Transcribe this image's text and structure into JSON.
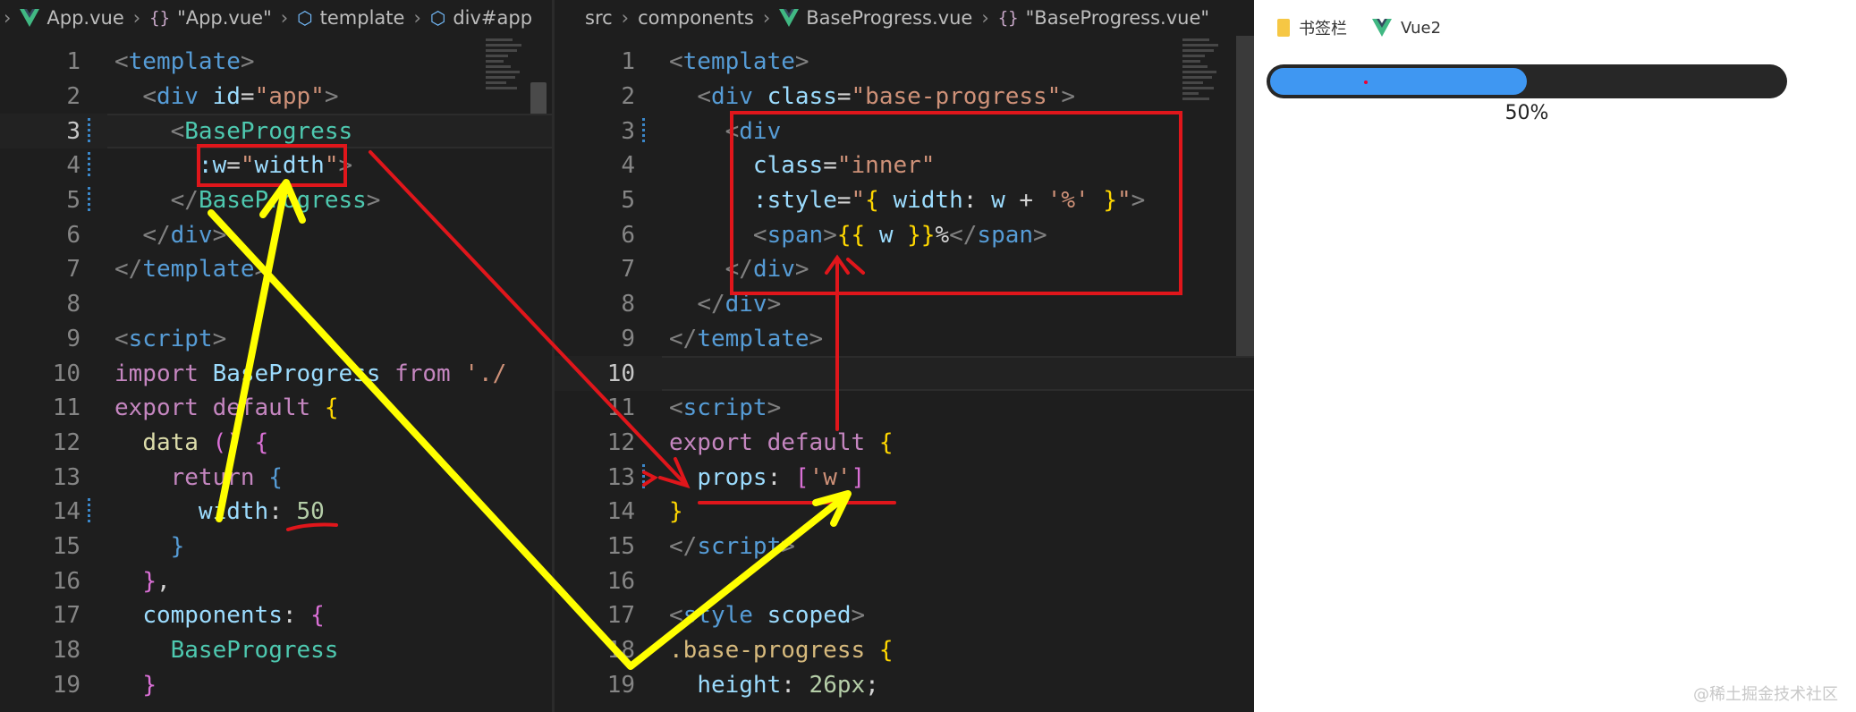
{
  "left_editor": {
    "breadcrumb": [
      "App.vue",
      "\"App.vue\"",
      "template",
      "div#app"
    ]
  },
  "right_editor": {
    "breadcrumb": [
      "src",
      "components",
      "BaseProgress.vue",
      "\"BaseProgress.vue\""
    ]
  },
  "browser": {
    "bookmarks": [
      "书签栏",
      "Vue2"
    ],
    "progress": {
      "percent": 50,
      "label": "50%"
    },
    "watermark": "@稀土掘金技术社区"
  },
  "colors": {
    "progress_fill": "#3f97f2",
    "progress_track": "#272727",
    "annotation_red": "#e0161b",
    "annotation_yellow": "#ffff00"
  }
}
